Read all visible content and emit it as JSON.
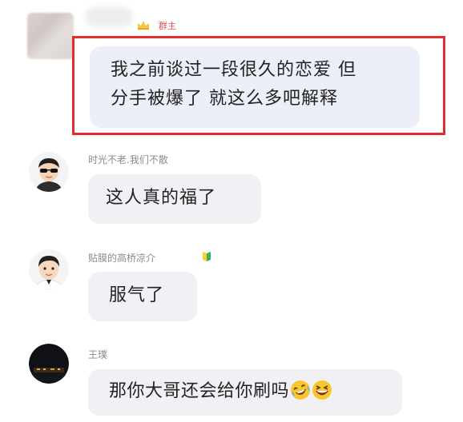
{
  "messages": [
    {
      "sender": "",
      "badge": "群主",
      "text_line1": "我之前谈过一段很久的恋爱 但",
      "text_line2": "分手被爆了 就这么多吧解释",
      "highlighted": true
    },
    {
      "sender": "时光不老.我们不散",
      "text": "这人真的福了"
    },
    {
      "sender": "贴膜的高桥凉介",
      "text": "服气了"
    },
    {
      "sender": "王璞",
      "text": "那你大哥还会给你刷吗",
      "emojis": [
        "rolling-laughing-emoji",
        "grinning-squint-emoji"
      ]
    }
  ],
  "colors": {
    "highlight_border": "#e32c2e",
    "owner_badge": "#e2504f",
    "bubble_bg": "#f1f1f5",
    "sender_name": "#8a8a8a"
  }
}
